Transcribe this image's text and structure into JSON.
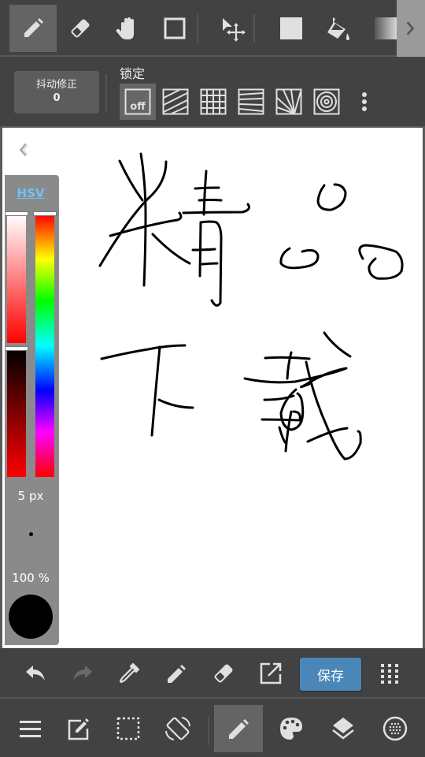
{
  "top_toolbar": {
    "tools": [
      {
        "name": "pen-tool",
        "icon": "pencil-icon",
        "active": true
      },
      {
        "name": "eraser-tool",
        "icon": "eraser-icon",
        "active": false
      },
      {
        "name": "hand-tool",
        "icon": "hand-icon",
        "active": false
      },
      {
        "name": "shape-tool",
        "icon": "square-outline-icon",
        "active": false
      },
      {
        "name": "move-tool",
        "icon": "move-cursor-icon",
        "active": false
      },
      {
        "name": "fill-color-tool",
        "icon": "filled-square-icon",
        "active": false
      },
      {
        "name": "bucket-tool",
        "icon": "paint-bucket-icon",
        "active": false
      },
      {
        "name": "gradient-tool",
        "icon": "gradient-icon",
        "active": false
      }
    ],
    "more_icon": "chevron-right-icon"
  },
  "sub_toolbar": {
    "stabilizer_label": "抖动修正",
    "stabilizer_value": "0",
    "lock_label": "锁定",
    "lock_options": [
      {
        "name": "off",
        "label": "off",
        "active": true
      },
      {
        "name": "parallel",
        "active": false
      },
      {
        "name": "grid",
        "active": false
      },
      {
        "name": "perspective-lines",
        "active": false
      },
      {
        "name": "radial",
        "active": false
      },
      {
        "name": "concentric",
        "active": false
      }
    ],
    "overflow_icon": "more-vertical-icon"
  },
  "color_panel": {
    "mode_label": "HSV",
    "brush_size": "5 px",
    "opacity": "100 %",
    "current_color": "#000000",
    "hue_position": 0.0,
    "saturation_position": 0.0,
    "value_position": 0.0
  },
  "canvas": {
    "collapse_icon": "double-chevron-left-icon",
    "stroke_color": "#000000"
  },
  "action_bar": {
    "items": [
      "undo",
      "redo",
      "eyedropper",
      "pen",
      "eraser",
      "export"
    ],
    "save_label": "保存",
    "grid_icon": "apps-grid-icon"
  },
  "bottom_nav": {
    "items": [
      "menu",
      "edit",
      "selection",
      "rotate",
      "brush",
      "color-palette",
      "layers",
      "materials"
    ],
    "active": "brush"
  },
  "colors": {
    "toolbar_bg": "#424242",
    "active_tool_bg": "#646464",
    "save_button": "#4a86b8",
    "hsv_link": "#6fc3ff",
    "panel_bg": "#8a8a8a"
  }
}
